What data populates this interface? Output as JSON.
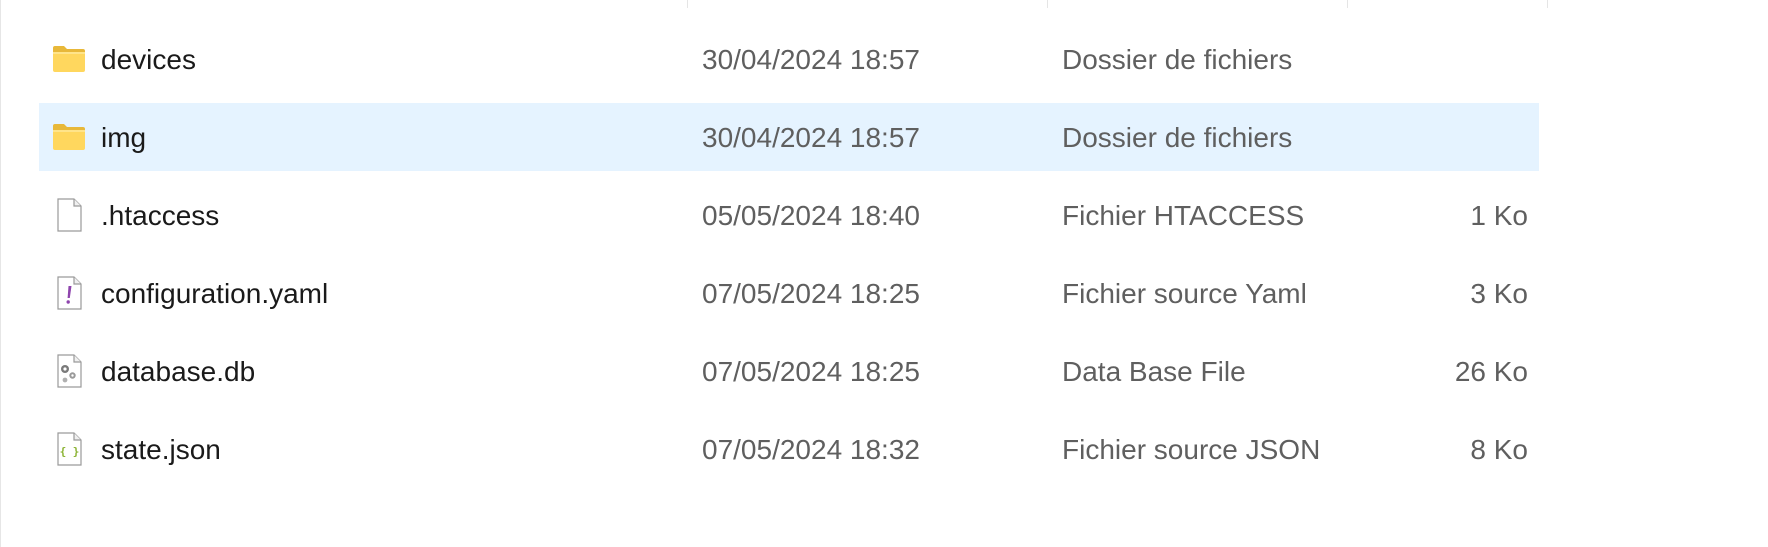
{
  "files": [
    {
      "name": "devices",
      "date": "30/04/2024 18:57",
      "type": "Dossier de fichiers",
      "size": "",
      "icon": "folder-icon",
      "selected": false
    },
    {
      "name": "img",
      "date": "30/04/2024 18:57",
      "type": "Dossier de fichiers",
      "size": "",
      "icon": "folder-icon",
      "selected": true
    },
    {
      "name": ".htaccess",
      "date": "05/05/2024 18:40",
      "type": "Fichier HTACCESS",
      "size": "1 Ko",
      "icon": "blank-file-icon",
      "selected": false
    },
    {
      "name": "configuration.yaml",
      "date": "07/05/2024 18:25",
      "type": "Fichier source Yaml",
      "size": "3 Ko",
      "icon": "yaml-file-icon",
      "selected": false
    },
    {
      "name": "database.db",
      "date": "07/05/2024 18:25",
      "type": "Data Base File",
      "size": "26 Ko",
      "icon": "settings-file-icon",
      "selected": false
    },
    {
      "name": "state.json",
      "date": "07/05/2024 18:32",
      "type": "Fichier source JSON",
      "size": "8 Ko",
      "icon": "json-file-icon",
      "selected": false
    }
  ],
  "colors": {
    "selection": "#e5f3ff",
    "folder": "#ffd75e",
    "name_text": "#1a1a1a",
    "meta_text": "#5f5f5f",
    "yaml_accent": "#8e44ad",
    "json_accent": "#8bb333"
  }
}
